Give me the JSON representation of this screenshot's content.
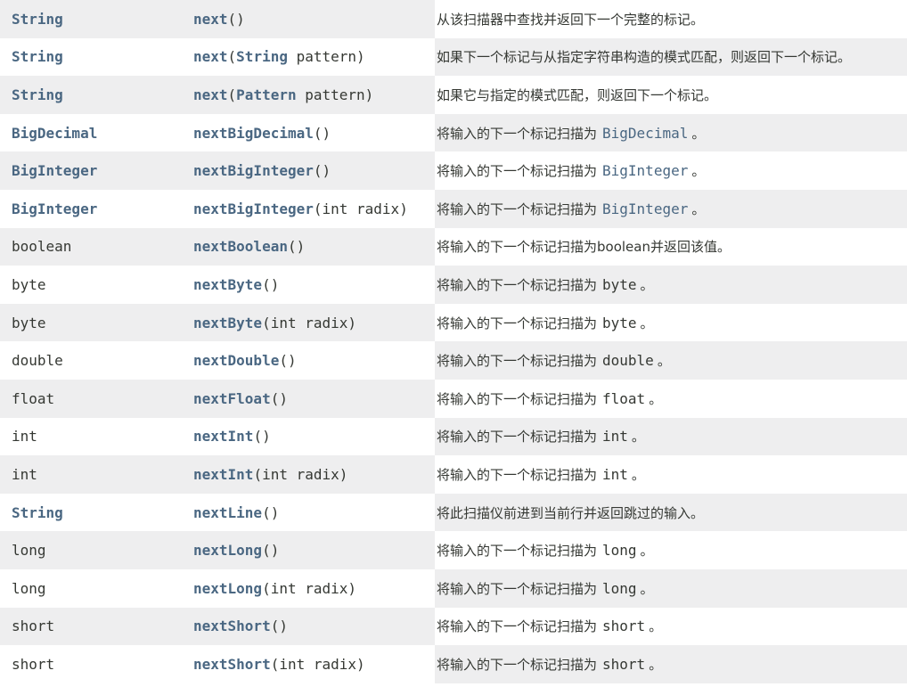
{
  "rows": [
    {
      "type": "String",
      "type_link": true,
      "method": "next",
      "params": "()",
      "desc": "从该扫描器中查找并返回下一个完整的标记。"
    },
    {
      "type": "String",
      "type_link": true,
      "method": "next",
      "params_open": "(",
      "param_type": "String",
      "param_name": " pattern)",
      "desc": "如果下一个标记与从指定字符串构造的模式匹配，则返回下一个标记。"
    },
    {
      "type": "String",
      "type_link": true,
      "method": "next",
      "params_open": "(",
      "param_type": "Pattern",
      "param_name": " pattern)",
      "desc": "如果它与指定的模式匹配，则返回下一个标记。"
    },
    {
      "type": "BigDecimal",
      "type_link": true,
      "method": "nextBigDecimal",
      "params": "()",
      "desc": "将输入的下一个标记扫描为",
      "desc_code": "BigDecimal",
      "desc_code_link": true,
      "desc_tail": "。"
    },
    {
      "type": "BigInteger",
      "type_link": true,
      "method": "nextBigInteger",
      "params": "()",
      "desc": "将输入的下一个标记扫描为",
      "desc_code": "BigInteger",
      "desc_code_link": true,
      "desc_tail": "。"
    },
    {
      "type": "BigInteger",
      "type_link": true,
      "method": "nextBigInteger",
      "params": "(int radix)",
      "desc": "将输入的下一个标记扫描为",
      "desc_code": "BigInteger",
      "desc_code_link": true,
      "desc_tail": "。"
    },
    {
      "type": "boolean",
      "type_link": false,
      "method": "nextBoolean",
      "params": "()",
      "desc": "将输入的下一个标记扫描为boolean并返回该值。"
    },
    {
      "type": "byte",
      "type_link": false,
      "method": "nextByte",
      "params": "()",
      "desc": "将输入的下一个标记扫描为",
      "desc_code": "byte",
      "desc_code_link": false,
      "desc_tail": "。"
    },
    {
      "type": "byte",
      "type_link": false,
      "method": "nextByte",
      "params": "(int radix)",
      "desc": "将输入的下一个标记扫描为",
      "desc_code": "byte",
      "desc_code_link": false,
      "desc_tail": "。"
    },
    {
      "type": "double",
      "type_link": false,
      "method": "nextDouble",
      "params": "()",
      "desc": "将输入的下一个标记扫描为",
      "desc_code": "double",
      "desc_code_link": false,
      "desc_tail": "。"
    },
    {
      "type": "float",
      "type_link": false,
      "method": "nextFloat",
      "params": "()",
      "desc": "将输入的下一个标记扫描为",
      "desc_code": "float",
      "desc_code_link": false,
      "desc_tail": "。"
    },
    {
      "type": "int",
      "type_link": false,
      "method": "nextInt",
      "params": "()",
      "desc": "将输入的下一个标记扫描为",
      "desc_code": "int",
      "desc_code_link": false,
      "desc_tail": "。"
    },
    {
      "type": "int",
      "type_link": false,
      "method": "nextInt",
      "params": "(int radix)",
      "desc": "将输入的下一个标记扫描为",
      "desc_code": "int",
      "desc_code_link": false,
      "desc_tail": "。"
    },
    {
      "type": "String",
      "type_link": true,
      "method": "nextLine",
      "params": "()",
      "desc": "将此扫描仪前进到当前行并返回跳过的输入。"
    },
    {
      "type": "long",
      "type_link": false,
      "method": "nextLong",
      "params": "()",
      "desc": "将输入的下一个标记扫描为",
      "desc_code": "long",
      "desc_code_link": false,
      "desc_tail": "。"
    },
    {
      "type": "long",
      "type_link": false,
      "method": "nextLong",
      "params": "(int radix)",
      "desc": "将输入的下一个标记扫描为",
      "desc_code": "long",
      "desc_code_link": false,
      "desc_tail": "。"
    },
    {
      "type": "short",
      "type_link": false,
      "method": "nextShort",
      "params": "()",
      "desc": "将输入的下一个标记扫描为",
      "desc_code": "short",
      "desc_code_link": false,
      "desc_tail": "。"
    },
    {
      "type": "short",
      "type_link": false,
      "method": "nextShort",
      "params": "(int radix)",
      "desc": "将输入的下一个标记扫描为",
      "desc_code": "short",
      "desc_code_link": false,
      "desc_tail": "。"
    }
  ]
}
